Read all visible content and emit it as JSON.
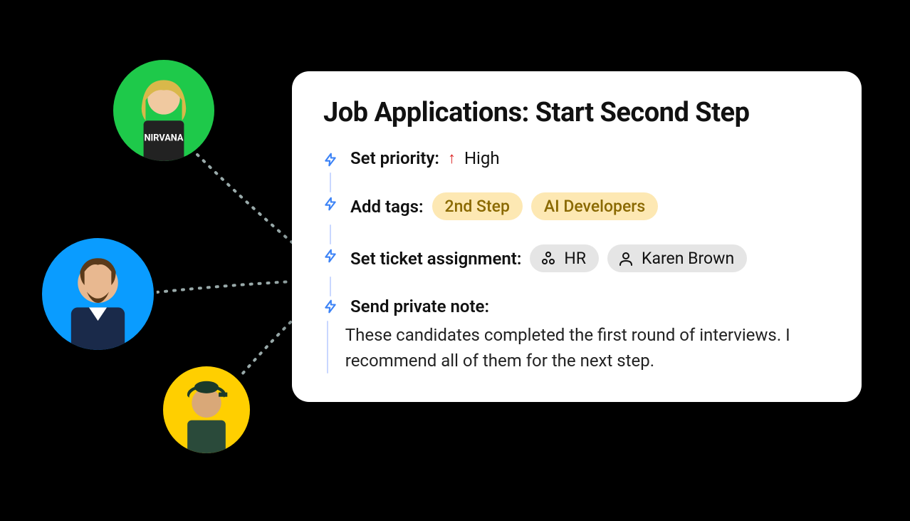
{
  "card": {
    "title": "Job Applications: Start Second Step",
    "steps": {
      "priority": {
        "label": "Set priority:",
        "value": "High"
      },
      "tags": {
        "label": "Add tags:",
        "items": [
          "2nd Step",
          "AI Developers"
        ]
      },
      "assignment": {
        "label": "Set ticket assignment:",
        "team": "HR",
        "person": "Karen Brown"
      },
      "note": {
        "label": "Send private note:",
        "text": "These candidates completed the first round of interviews. I recommend all of them for the next step."
      }
    }
  },
  "avatars": [
    {
      "name": "avatar-1",
      "bg": "#1ec94a"
    },
    {
      "name": "avatar-2",
      "bg": "#0a9cff"
    },
    {
      "name": "avatar-3",
      "bg": "#ffcf00"
    }
  ],
  "colors": {
    "accent_blue": "#3b82f6",
    "priority_red": "#dc2626",
    "tag_bg": "#fde8b3",
    "tag_text": "#8a6900",
    "chip_bg": "#e5e5e5"
  }
}
